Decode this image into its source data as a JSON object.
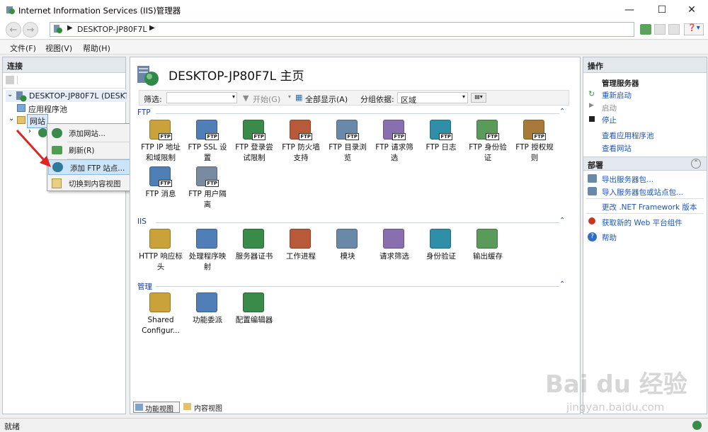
{
  "window": {
    "title": "Internet Information Services (IIS)管理器"
  },
  "address": {
    "path": "DESKTOP-JP80F7L"
  },
  "menu": [
    "文件(F)",
    "视图(V)",
    "帮助(H)"
  ],
  "connections": {
    "title": "连接",
    "server": "DESKTOP-JP80F7L (DESKTO",
    "app_pools": "应用程序池",
    "sites": "网站"
  },
  "context_menu": [
    "添加网站...",
    "刷新(R)",
    "添加 FTP 站点...",
    "切换到内容视图"
  ],
  "center": {
    "title": "DESKTOP-JP80F7L 主页",
    "filter_label": "筛选:",
    "start": "开始(G)",
    "show_all": "全部显示(A)",
    "group_by": "分组依据:",
    "group_value": "区域",
    "sections": [
      {
        "name": "FTP",
        "items": [
          [
            "FTP IP 地址",
            "和域限制"
          ],
          [
            "FTP SSL 设",
            "置"
          ],
          [
            "FTP 登录尝",
            "试限制"
          ],
          [
            "FTP 防火墙",
            "支持"
          ],
          [
            "FTP 目录浏",
            "览"
          ],
          [
            "FTP 请求筛",
            "选"
          ],
          [
            "FTP 日志"
          ],
          [
            "FTP 身份验",
            "证"
          ],
          [
            "FTP 授权规",
            "则"
          ],
          [
            "FTP 消息"
          ],
          [
            "FTP 用户隔",
            "离"
          ]
        ]
      },
      {
        "name": "IIS",
        "items": [
          [
            "HTTP 响应标",
            "头"
          ],
          [
            "处理程序映",
            "射"
          ],
          [
            "服务器证书"
          ],
          [
            "工作进程"
          ],
          [
            "模块"
          ],
          [
            "请求筛选"
          ],
          [
            "身份验证"
          ],
          [
            "输出缓存"
          ]
        ]
      },
      {
        "name": "管理",
        "items": [
          [
            "Shared",
            "Configur..."
          ],
          [
            "功能委派"
          ],
          [
            "配置编辑器"
          ]
        ]
      }
    ],
    "tabs": [
      "功能视图",
      "内容视图"
    ]
  },
  "actions": {
    "title": "操作",
    "manage_server": "管理服务器",
    "restart": "重新启动",
    "start": "启动",
    "stop": "停止",
    "view_pools": "查看应用程序池",
    "view_sites": "查看网站",
    "deploy": "部署",
    "export": "导出服务器包...",
    "import": "导入服务器包或站点包...",
    "dotnet": "更改 .NET Framework 版本",
    "webpi": "获取新的 Web 平台组件",
    "help": "帮助"
  },
  "status": {
    "text": "就绪"
  },
  "watermark": {
    "brand": "Bai du 经验",
    "url": "jingyan.baidu.com"
  },
  "colors": {
    "accent": "#1c56b8",
    "section_title": "#1c3f94",
    "selection": "#cce4f7"
  }
}
